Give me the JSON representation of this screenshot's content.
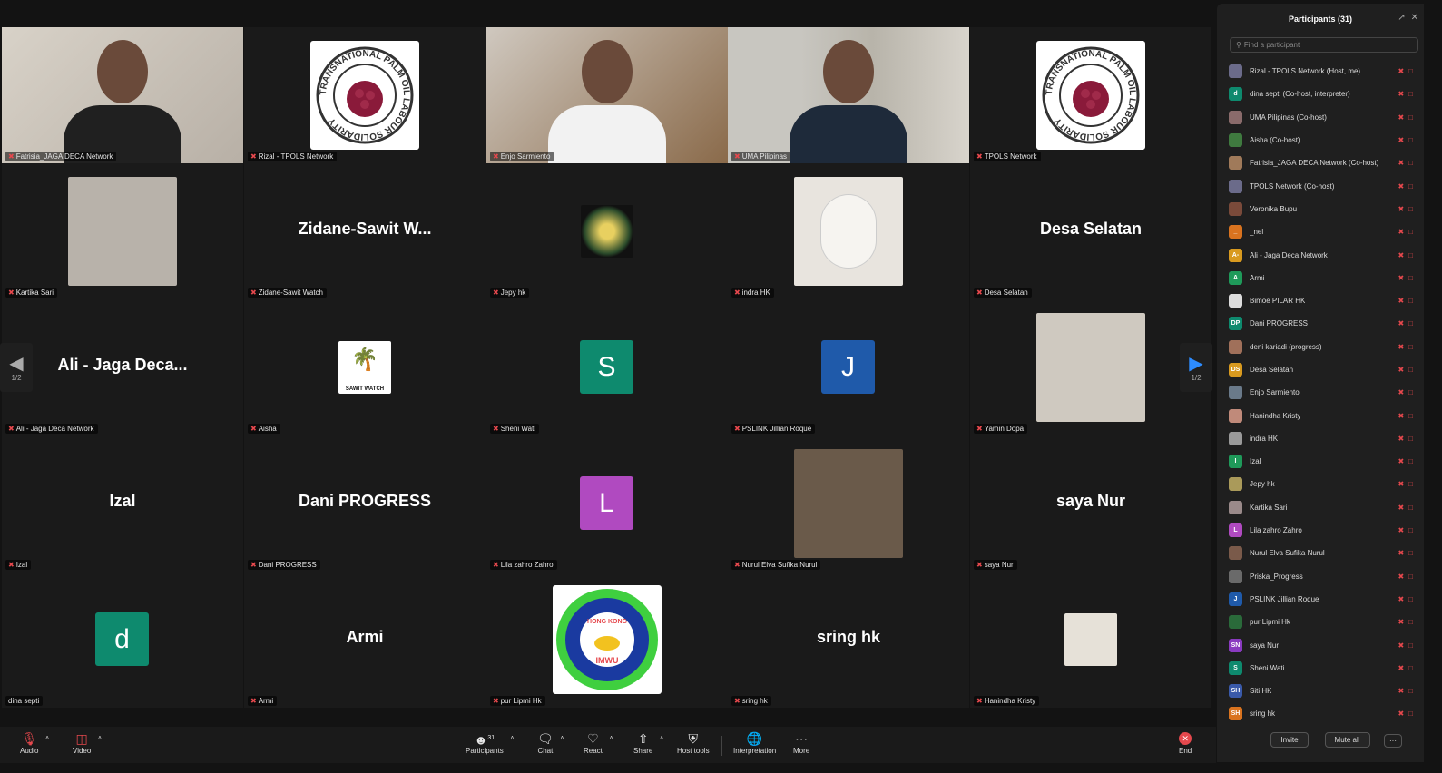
{
  "grid": {
    "tiles": [
      {
        "label": "Fatrisia_JAGA DECA Network",
        "type": "video"
      },
      {
        "label": "Rizal - TPOLS Network",
        "type": "logo"
      },
      {
        "label": "Enjo Sarmiento",
        "type": "video"
      },
      {
        "label": "UMA Pilipinas",
        "type": "video"
      },
      {
        "label": "TPOLS Network",
        "type": "logo"
      },
      {
        "label": "Kartika Sari",
        "type": "photo"
      },
      {
        "label": "Zidane-Sawit Watch",
        "display": "Zidane-Sawit W...",
        "type": "name"
      },
      {
        "label": "Jepy hk",
        "type": "photo"
      },
      {
        "label": "indra HK",
        "type": "photo"
      },
      {
        "label": "Desa Selatan",
        "display": "Desa Selatan",
        "type": "name"
      },
      {
        "label": "Ali - Jaga Deca Network",
        "display": "Ali - Jaga Deca...",
        "type": "name"
      },
      {
        "label": "Aisha",
        "logo_text": "SAWIT WATCH",
        "type": "photo"
      },
      {
        "label": "Sheni Wati",
        "initial": "S",
        "type": "initial"
      },
      {
        "label": "PSLINK Jillian Roque",
        "initial": "J",
        "type": "initial"
      },
      {
        "label": "Yamin Dopa",
        "type": "photo"
      },
      {
        "label": "Izal",
        "display": "Izal",
        "type": "name"
      },
      {
        "label": "Dani PROGRESS",
        "display": "Dani PROGRESS",
        "type": "name"
      },
      {
        "label": "Lila zahro Zahro",
        "initial": "L",
        "type": "initial"
      },
      {
        "label": "Nurul Elva Sufika Nurul",
        "type": "photo"
      },
      {
        "label": "saya Nur",
        "display": "saya Nur",
        "type": "name"
      },
      {
        "label": "dina septi",
        "initial": "d",
        "type": "initial"
      },
      {
        "label": "Armi",
        "display": "Armi",
        "type": "name"
      },
      {
        "label": "pur Lipmi Hk",
        "type": "logo2"
      },
      {
        "label": "sring hk",
        "display": "sring hk",
        "type": "name"
      },
      {
        "label": "Hanindha Kristy",
        "type": "photo"
      }
    ],
    "logo_ring_text": "TRANSNATIONAL PALM OIL LABOUR SOLIDARITY",
    "imwu_text": "IMWU",
    "imwu_top": "HONG KONG",
    "page_indicator": "1/2"
  },
  "panel": {
    "title": "Participants (31)",
    "search_placeholder": "Find a participant",
    "participants": [
      {
        "name": "Rizal - TPOLS Network (Host, me)",
        "av": "",
        "color": "#6b6b8a"
      },
      {
        "name": "dina septi (Co-host, interpreter)",
        "av": "d",
        "color": "#0e8a6e"
      },
      {
        "name": "UMA Pilipinas (Co-host)",
        "av": "",
        "color": "#8a6b6b"
      },
      {
        "name": "Aisha (Co-host)",
        "av": "",
        "color": "#3f7a3f"
      },
      {
        "name": "Fatrisia_JAGA DECA Network (Co-host)",
        "av": "",
        "color": "#a07a5a"
      },
      {
        "name": "TPOLS Network (Co-host)",
        "av": "",
        "color": "#6b6b8a"
      },
      {
        "name": "Veronika Bupu",
        "av": "",
        "color": "#7a4a3a"
      },
      {
        "name": "_nel",
        "av": "_",
        "color": "#d9731f"
      },
      {
        "name": "Ali - Jaga Deca Network",
        "av": "A-",
        "color": "#d99a1f"
      },
      {
        "name": "Armi",
        "av": "A",
        "color": "#1f9a5a"
      },
      {
        "name": "Bimoe PILAR HK",
        "av": "",
        "color": "#ddd"
      },
      {
        "name": "Dani PROGRESS",
        "av": "DP",
        "color": "#0e8a6e"
      },
      {
        "name": "deni kariadi (progress)",
        "av": "",
        "color": "#a0705a"
      },
      {
        "name": "Desa Selatan",
        "av": "DS",
        "color": "#d99a1f"
      },
      {
        "name": "Enjo Sarmiento",
        "av": "",
        "color": "#6a7a8a"
      },
      {
        "name": "Hanindha Kristy",
        "av": "",
        "color": "#c08a7a"
      },
      {
        "name": "indra HK",
        "av": "",
        "color": "#9a9a9a"
      },
      {
        "name": "Izal",
        "av": "I",
        "color": "#1f9a5a"
      },
      {
        "name": "Jepy hk",
        "av": "",
        "color": "#aa9a5a"
      },
      {
        "name": "Kartika Sari",
        "av": "",
        "color": "#9a8a8a"
      },
      {
        "name": "Lila zahro Zahro",
        "av": "L",
        "color": "#b04ac0"
      },
      {
        "name": "Nurul Elva Sufika Nurul",
        "av": "",
        "color": "#7a5a4a"
      },
      {
        "name": "Priska_Progress",
        "av": "",
        "color": "#6a6a6a"
      },
      {
        "name": "PSLINK Jillian Roque",
        "av": "J",
        "color": "#1f5aaa"
      },
      {
        "name": "pur Lipmi Hk",
        "av": "",
        "color": "#2a6a3a"
      },
      {
        "name": "saya Nur",
        "av": "SN",
        "color": "#8a3ac0"
      },
      {
        "name": "Sheni Wati",
        "av": "S",
        "color": "#0e8a6e"
      },
      {
        "name": "Siti HK",
        "av": "SH",
        "color": "#3a5aaa"
      },
      {
        "name": "sring hk",
        "av": "SH",
        "color": "#d9731f"
      }
    ],
    "invite_label": "Invite",
    "mute_all_label": "Mute all",
    "more_label": "···"
  },
  "toolbar": {
    "audio": "Audio",
    "video": "Video",
    "participants": "Participants",
    "participants_count": "31",
    "chat": "Chat",
    "react": "React",
    "share": "Share",
    "host_tools": "Host tools",
    "interpretation": "Interpretation",
    "more": "More",
    "end": "End"
  },
  "colors": {
    "accent_green": "#2bd67b",
    "mute_red": "#e5484d",
    "bg": "#131313"
  }
}
